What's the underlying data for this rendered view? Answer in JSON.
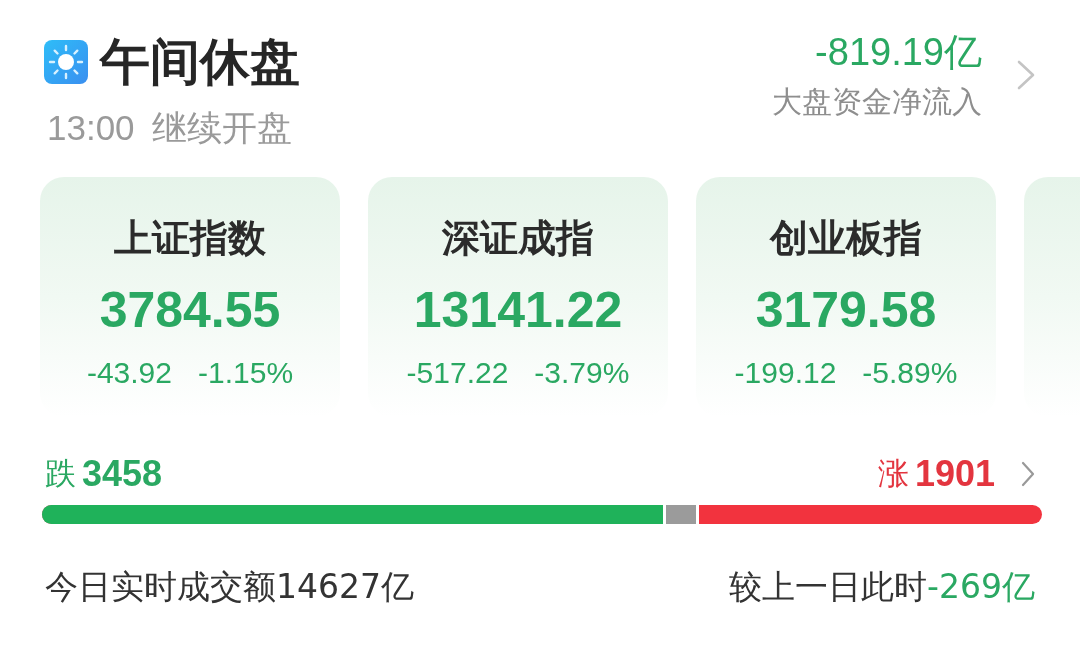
{
  "header": {
    "title": "午间休盘",
    "subtitle": "13:00 继续开盘"
  },
  "net_flow": {
    "value": "-819.19亿",
    "label": "大盘资金净流入",
    "falling": true
  },
  "indices": [
    {
      "name": "上证指数",
      "value": "3784.55",
      "change": "-43.92",
      "change_pct": "-1.15%",
      "falling": true
    },
    {
      "name": "深证成指",
      "value": "13141.22",
      "change": "-517.22",
      "change_pct": "-3.79%",
      "falling": true
    },
    {
      "name": "创业板指",
      "value": "3179.58",
      "change": "-199.12",
      "change_pct": "-5.89%",
      "falling": true
    }
  ],
  "more_indices": true,
  "breadth": {
    "down": {
      "label": "跌",
      "count": "3458"
    },
    "up": {
      "label": "涨",
      "count": "1901"
    },
    "fills": [
      {
        "level": 0.624,
        "color": "#1fb25a"
      },
      {
        "level": 0.657,
        "color": "#9b9b9b"
      }
    ]
  },
  "turnover": {
    "text": "今日实时成交额14627亿",
    "compare_label": "较上一日此时",
    "compare_value": "-269亿",
    "compare_falling": true
  }
}
